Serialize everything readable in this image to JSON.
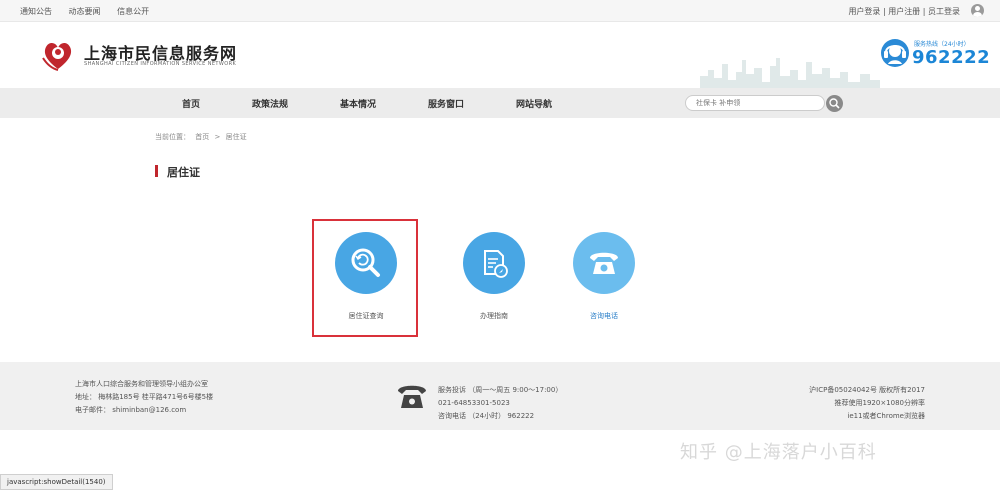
{
  "topbar": {
    "links": [
      "通知公告",
      "动态要闻",
      "信息公开"
    ],
    "user_links": "用户登录 | 用户注册 | 员工登录"
  },
  "header": {
    "title": "上海市民信息服务网",
    "subtitle": "SHANGHAI CITIZEN INFORMATION SERVICE NETWORK",
    "hotline_label": "服务热线（24小时）",
    "hotline_number": "962222"
  },
  "nav": {
    "items": [
      "首页",
      "政策法规",
      "基本情况",
      "服务窗口",
      "网站导航"
    ],
    "search_placeholder": "社保卡 补申领"
  },
  "breadcrumb": {
    "label": "当前位置：",
    "home": "首页",
    "sep": ">",
    "current": "居住证"
  },
  "page_title": "居住证",
  "services": [
    {
      "label": "居住证查询",
      "icon": "search-refresh-icon"
    },
    {
      "label": "办理指南",
      "icon": "document-compass-icon"
    },
    {
      "label": "咨询电话",
      "icon": "telephone-icon"
    }
  ],
  "footer": {
    "org": "上海市人口综合服务和管理领导小组办公室",
    "address": "地址：      梅林路185号    桂平路471号6号楼5楼",
    "email": "电子邮件：   shiminban@126.com",
    "service_hours": "服务投诉  （周一～周五 9:00～17:00）",
    "phone": "021-64853301-5023",
    "consult": "咨询电话  （24小时）  962222",
    "icp": "沪ICP备05024042号 版权所有2017",
    "resolution": "推荐使用1920×1080分辨率",
    "browser": "ie11或者Chrome浏览器"
  },
  "watermark": "知乎 @上海落户小百科",
  "status_text": "javascript:showDetail(1540)",
  "colors": {
    "brand_red": "#c0262d",
    "icon_blue": "#48a6e4",
    "hotline_blue": "#1c86d6",
    "highlight_red": "#d9313a"
  }
}
